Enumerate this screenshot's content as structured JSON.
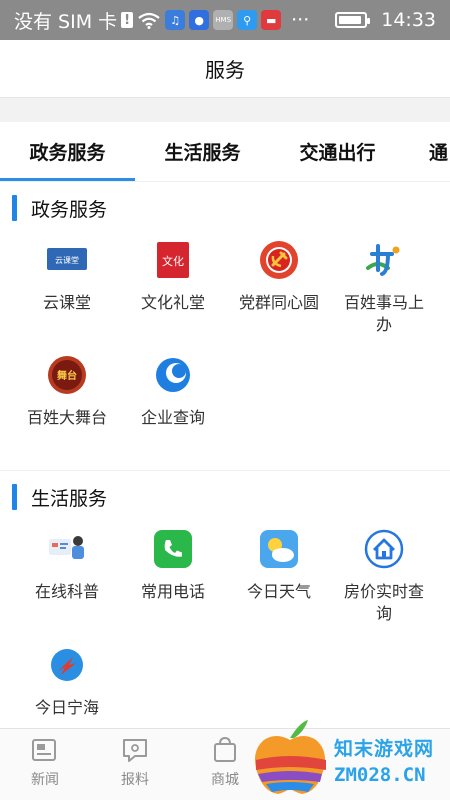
{
  "status_bar": {
    "carrier": "没有 SIM 卡",
    "time": "14:33",
    "icons": [
      "sim-alert-icon",
      "wifi-icon",
      "music-app-icon",
      "baidu-app-icon",
      "hms-app-icon",
      "search-app-icon",
      "huawei-app-icon",
      "more-icon",
      "battery-icon"
    ],
    "hms_label": "HMS",
    "more_label": "···"
  },
  "header": {
    "title": "服务"
  },
  "tabs": [
    {
      "label": "政务服务",
      "active": true
    },
    {
      "label": "生活服务",
      "active": false
    },
    {
      "label": "交通出行",
      "active": false
    },
    {
      "label": "通",
      "active": false
    }
  ],
  "sections": [
    {
      "title": "政务服务",
      "items": [
        {
          "label": "云课堂",
          "icon": "cloud-classroom-icon",
          "icon_text": "云课堂"
        },
        {
          "label": "文化礼堂",
          "icon": "culture-hall-icon",
          "icon_text": "文化"
        },
        {
          "label": "党群同心圆",
          "icon": "party-emblem-icon"
        },
        {
          "label": "百姓事马上办",
          "icon": "affairs-icon"
        },
        {
          "label": "百姓大舞台",
          "icon": "stage-icon",
          "icon_text": "舞台"
        },
        {
          "label": "企业查询",
          "icon": "enterprise-query-icon"
        }
      ]
    },
    {
      "title": "生活服务",
      "items": [
        {
          "label": "在线科普",
          "icon": "science-icon"
        },
        {
          "label": "常用电话",
          "icon": "phone-icon"
        },
        {
          "label": "今日天气",
          "icon": "weather-icon"
        },
        {
          "label": "房价实时查询",
          "icon": "house-icon"
        },
        {
          "label": "今日宁海",
          "icon": "ninghai-icon"
        }
      ]
    }
  ],
  "bottom_nav": [
    {
      "label": "新闻",
      "icon": "news-icon"
    },
    {
      "label": "报料",
      "icon": "report-icon"
    },
    {
      "label": "商城",
      "icon": "mall-icon"
    }
  ],
  "watermark": {
    "line1": "知末游戏网",
    "line2": "ZM028.CN"
  },
  "colors": {
    "accent": "#2b8de8",
    "status_bar": "#8a8a8a",
    "section_bar": "#1f86e8"
  }
}
